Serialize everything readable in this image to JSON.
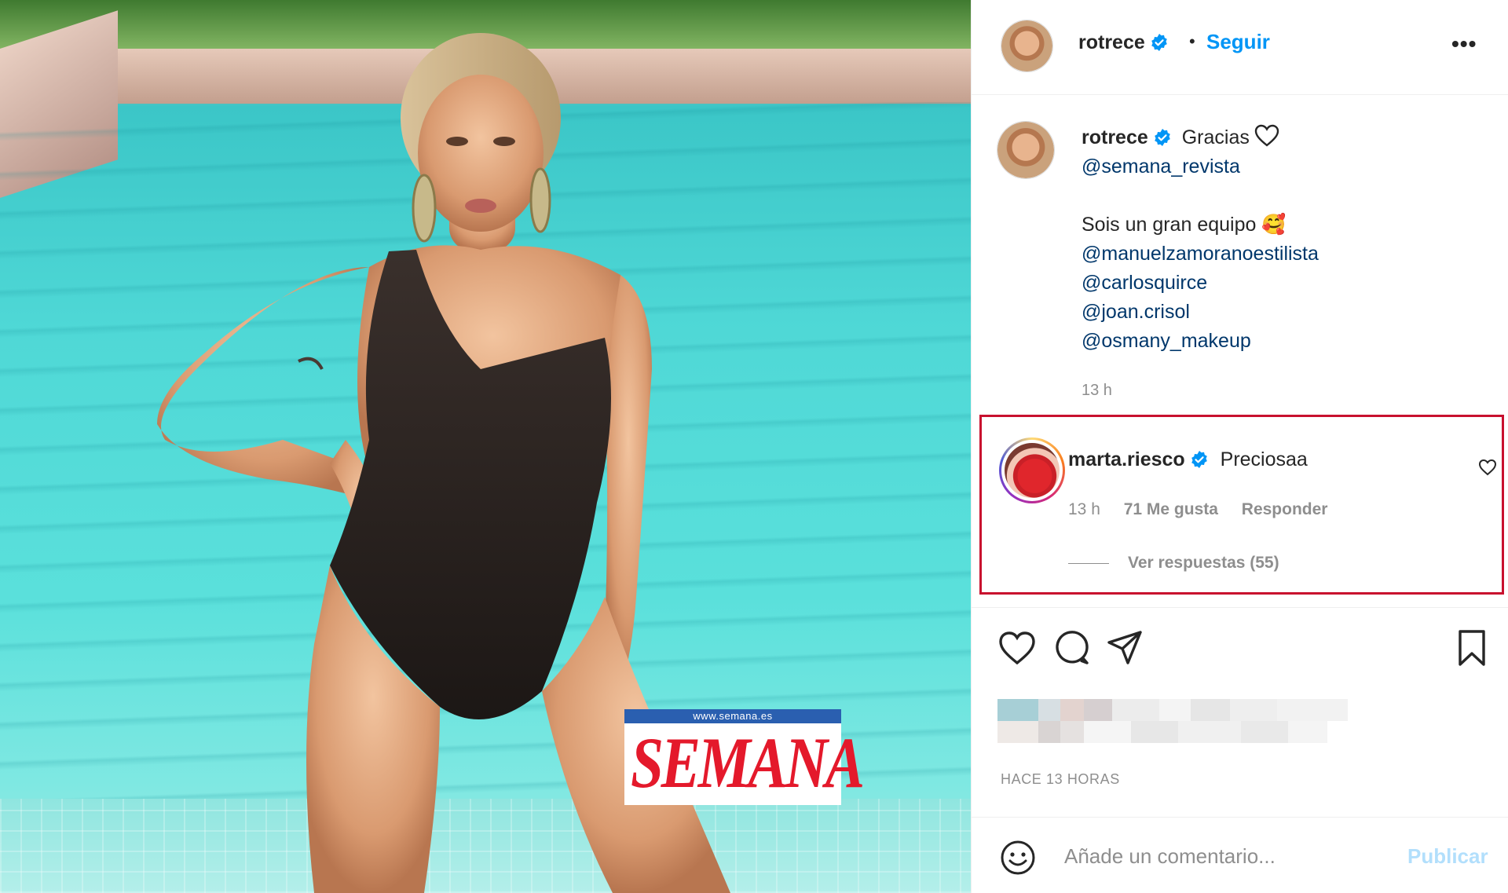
{
  "post_image": {
    "watermark_url": "www.semana.es",
    "watermark_brand": "SEMANA"
  },
  "header": {
    "username": "rotrece",
    "separator": "•",
    "follow_label": "Seguir",
    "more_label": "•••"
  },
  "caption": {
    "username": "rotrece",
    "text_line1": "Gracias",
    "mention_1": "@semana_revista",
    "text_line2": "Sois un gran equipo 🥰",
    "mentions": [
      "@manuelzamoranoestilista",
      "@carlosquirce",
      "@joan.crisol",
      "@osmany_makeup"
    ],
    "time": "13 h"
  },
  "comment": {
    "username": "marta.riesco",
    "text": "Preciosaa",
    "time": "13 h",
    "likes": "71 Me gusta",
    "reply_label": "Responder",
    "view_replies": "Ver respuestas (55)",
    "highlight_color": "#c8102e"
  },
  "actions": {
    "icons": [
      "heart-icon",
      "comment-icon",
      "share-icon",
      "bookmark-icon"
    ]
  },
  "posted_time": "HACE 13 HORAS",
  "add_comment": {
    "placeholder": "Añade un comentario...",
    "publish_label": "Publicar"
  },
  "colors": {
    "link": "#0095f6",
    "mention": "#00376b",
    "muted": "#8e8e8e",
    "publish_disabled": "#b2dffc",
    "verified": "#0095f6"
  }
}
